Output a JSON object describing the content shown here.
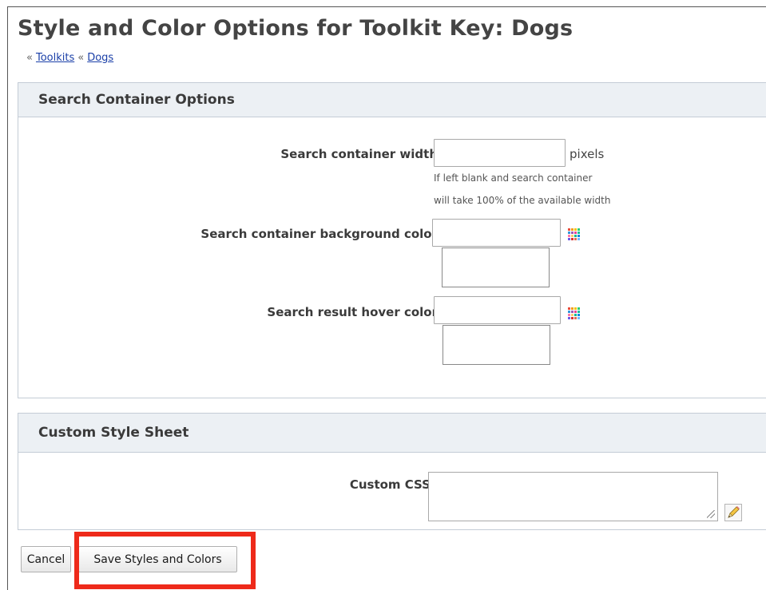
{
  "page": {
    "title": "Style and Color Options for Toolkit Key: Dogs",
    "breadcrumb": {
      "prefix": "«",
      "separator": "«",
      "link1": "Toolkits",
      "link2": "Dogs"
    }
  },
  "search_container_options": {
    "header": "Search Container Options",
    "width_label": "Search container width",
    "width_value": "",
    "width_unit": "pixels",
    "width_hint_line1": "If left blank and search container",
    "width_hint_line2": "will take 100% of the available width",
    "bg_color_label": "Search container background color",
    "bg_color_value": "",
    "hover_color_label": "Search result hover color",
    "hover_color_value": ""
  },
  "custom_style_sheet": {
    "header": "Custom Style Sheet",
    "css_label": "Custom CSS",
    "css_value": ""
  },
  "actions": {
    "cancel_label": "Cancel",
    "save_label": "Save Styles and Colors"
  },
  "icons": {
    "color_picker": "color-palette-icon",
    "editor": "pencil-icon"
  },
  "colors": {
    "highlight": "#ee2a1a",
    "link": "#1a3fa8",
    "panel_header_bg": "#ecf0f4",
    "palette": [
      "#e74c3c",
      "#f39c12",
      "#f1c40f",
      "#2ecc71",
      "#3498db",
      "#9b59b6",
      "#e84393",
      "#1abc9c",
      "#fd79a8",
      "#fdcb6e",
      "#00b894",
      "#0984e3",
      "#6c5ce7",
      "#d63031",
      "#e17055",
      "#74b9ff"
    ]
  }
}
